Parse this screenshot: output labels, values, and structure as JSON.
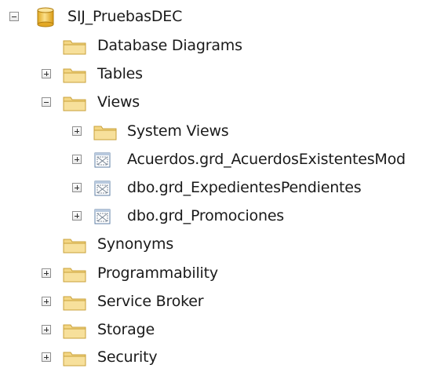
{
  "tree": {
    "database": {
      "label": "SIJ_PruebasDEC",
      "expanded": true,
      "icon": "database-icon"
    },
    "folders": {
      "database_diagrams": {
        "label": "Database Diagrams",
        "icon": "folder-icon",
        "expandable": false
      },
      "tables": {
        "label": "Tables",
        "icon": "folder-icon",
        "expandable": true,
        "expanded": false
      },
      "views": {
        "label": "Views",
        "icon": "folder-icon",
        "expandable": true,
        "expanded": true
      },
      "synonyms": {
        "label": "Synonyms",
        "icon": "folder-icon",
        "expandable": false
      },
      "programmability": {
        "label": "Programmability",
        "icon": "folder-icon",
        "expandable": true,
        "expanded": false
      },
      "service_broker": {
        "label": "Service Broker",
        "icon": "folder-icon",
        "expandable": true,
        "expanded": false
      },
      "storage": {
        "label": "Storage",
        "icon": "folder-icon",
        "expandable": true,
        "expanded": false
      },
      "security": {
        "label": "Security",
        "icon": "folder-icon",
        "expandable": true,
        "expanded": false
      }
    },
    "views_children": {
      "system_views": {
        "label": "System Views",
        "icon": "folder-icon"
      },
      "view_1": {
        "label": "Acuerdos.grd_AcuerdosExistentesMod",
        "icon": "view-icon"
      },
      "view_2": {
        "label": "dbo.grd_ExpedientesPendientes",
        "icon": "view-icon"
      },
      "view_3": {
        "label": "dbo.grd_Promociones",
        "icon": "view-icon"
      }
    }
  },
  "colors": {
    "folder_fill": "#f3d684",
    "folder_border": "#c9a13a",
    "database_fill": "#f2c84b",
    "view_border": "#5f7fa6",
    "expander_border": "#8e8e8e"
  }
}
